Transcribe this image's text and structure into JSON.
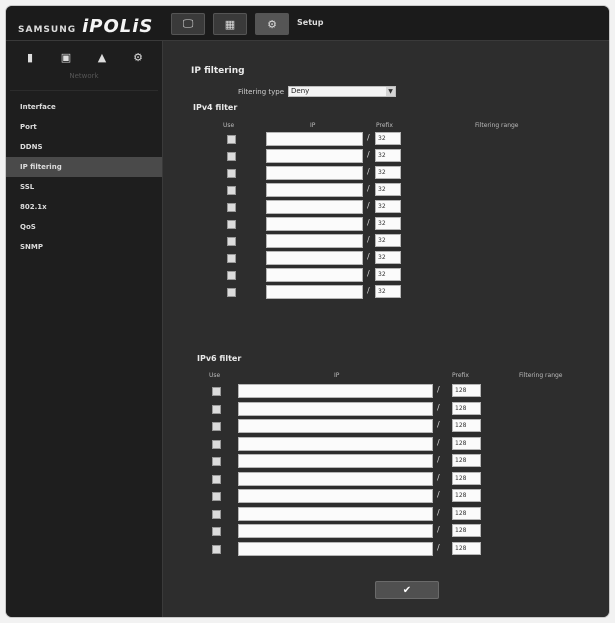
{
  "brand": {
    "samsung": "SAMSUNG",
    "ipolis": "iPOLiS"
  },
  "topbar": {
    "buttons": [
      {
        "name": "monitor",
        "glyph": "🖵"
      },
      {
        "name": "playback",
        "glyph": "▦"
      },
      {
        "name": "setup",
        "glyph": "⚙"
      }
    ],
    "label": "Setup"
  },
  "sidebar": {
    "icons": [
      "▮",
      "▣",
      "▲",
      "⚙"
    ],
    "heading": "Network",
    "items": [
      {
        "label": "Interface",
        "selected": false
      },
      {
        "label": "Port",
        "selected": false
      },
      {
        "label": "DDNS",
        "selected": false
      },
      {
        "label": "IP filtering",
        "selected": true
      },
      {
        "label": "SSL",
        "selected": false
      },
      {
        "label": "802.1x",
        "selected": false
      },
      {
        "label": "QoS",
        "selected": false
      },
      {
        "label": "SNMP",
        "selected": false
      }
    ]
  },
  "main": {
    "title": "IP filtering",
    "filtering_type_label": "Filtering type",
    "filtering_type_value": "Deny",
    "ipv4": {
      "title": "IPv4 filter",
      "headers": {
        "use": "Use",
        "ip": "IP",
        "prefix": "Prefix",
        "range": "Filtering range"
      },
      "rows": [
        {
          "use": true,
          "ip": "",
          "prefix": "32"
        },
        {
          "use": true,
          "ip": "",
          "prefix": "32"
        },
        {
          "use": true,
          "ip": "",
          "prefix": "32"
        },
        {
          "use": true,
          "ip": "",
          "prefix": "32"
        },
        {
          "use": true,
          "ip": "",
          "prefix": "32"
        },
        {
          "use": true,
          "ip": "",
          "prefix": "32"
        },
        {
          "use": true,
          "ip": "",
          "prefix": "32"
        },
        {
          "use": true,
          "ip": "",
          "prefix": "32"
        },
        {
          "use": true,
          "ip": "",
          "prefix": "32"
        },
        {
          "use": true,
          "ip": "",
          "prefix": "32"
        }
      ]
    },
    "ipv6": {
      "title": "IPv6 filter",
      "headers": {
        "use": "Use",
        "ip": "IP",
        "prefix": "Prefix",
        "range": "Filtering range"
      },
      "rows": [
        {
          "use": true,
          "ip": "",
          "prefix": "128"
        },
        {
          "use": true,
          "ip": "",
          "prefix": "128"
        },
        {
          "use": true,
          "ip": "",
          "prefix": "128"
        },
        {
          "use": true,
          "ip": "",
          "prefix": "128"
        },
        {
          "use": true,
          "ip": "",
          "prefix": "128"
        },
        {
          "use": true,
          "ip": "",
          "prefix": "128"
        },
        {
          "use": true,
          "ip": "",
          "prefix": "128"
        },
        {
          "use": true,
          "ip": "",
          "prefix": "128"
        },
        {
          "use": true,
          "ip": "",
          "prefix": "128"
        },
        {
          "use": true,
          "ip": "",
          "prefix": "128"
        }
      ]
    },
    "apply_glyph": "✔"
  }
}
